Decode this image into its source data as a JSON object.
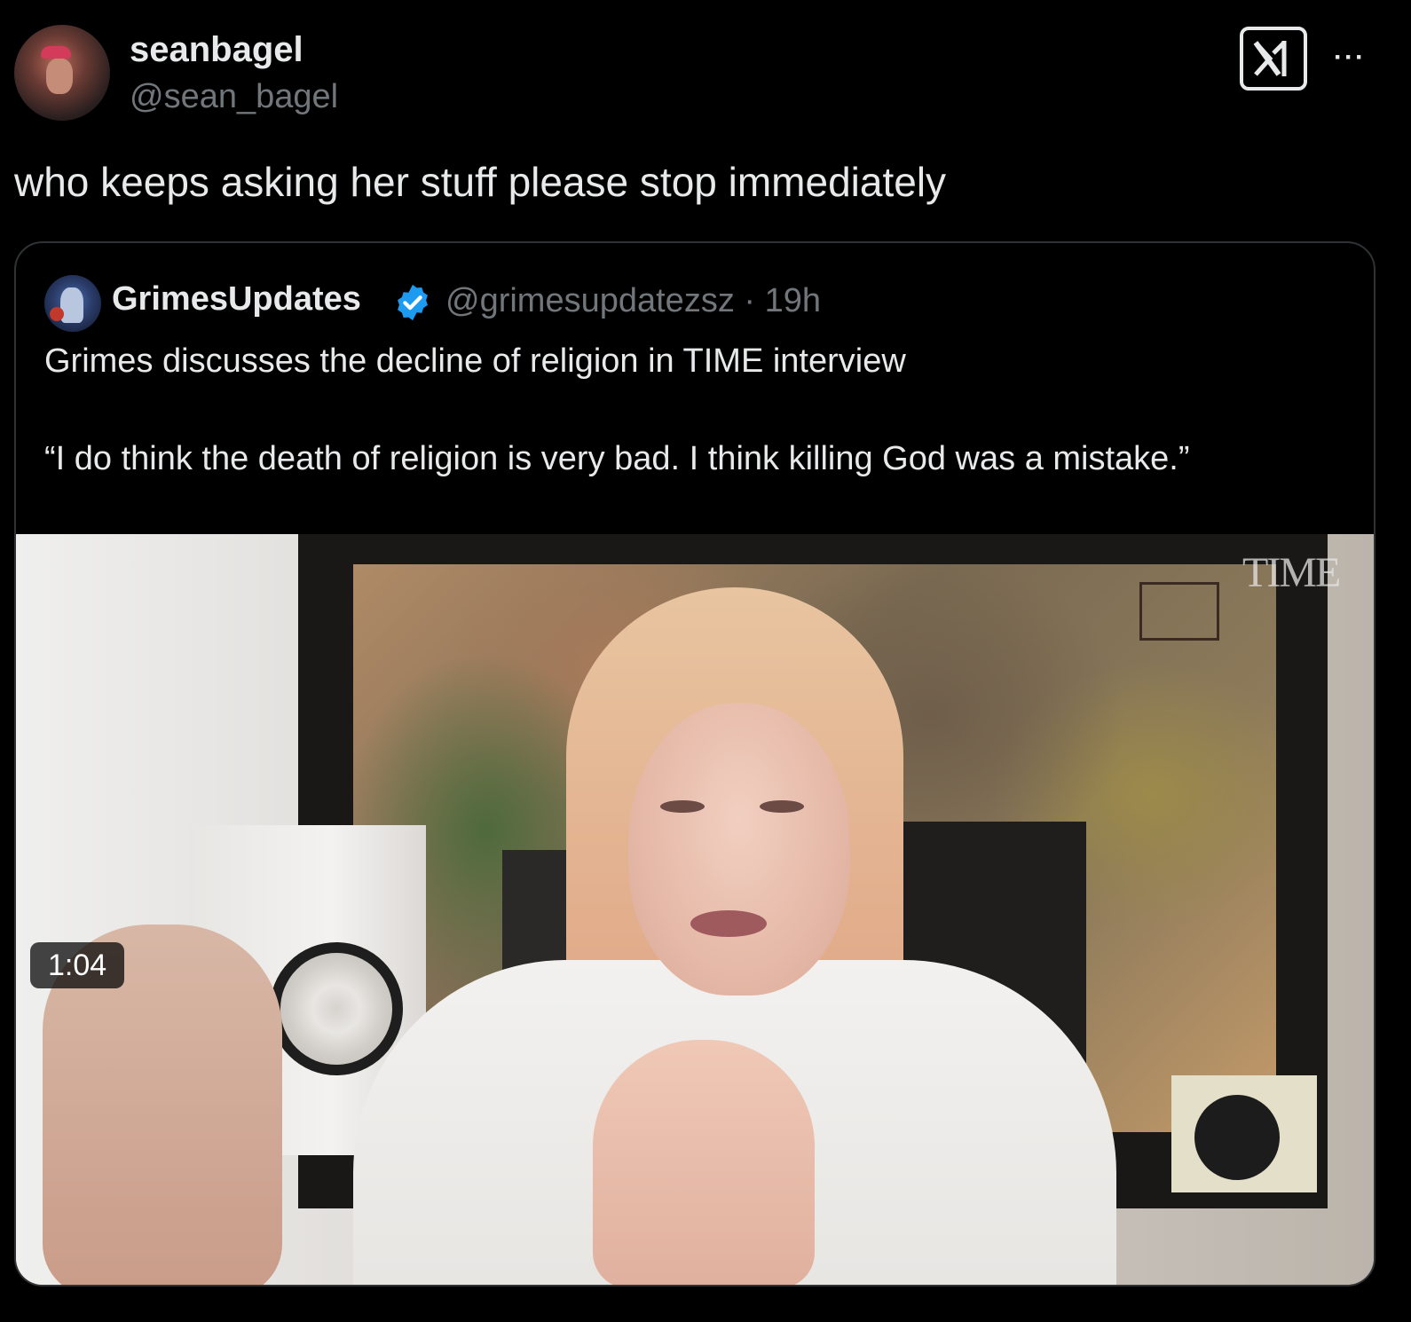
{
  "author": {
    "display_name": "seanbagel",
    "handle": "@sean_bagel"
  },
  "icons": {
    "logo": "x-logo-icon",
    "more": "more-options-icon",
    "verified": "verified-badge-icon"
  },
  "tweet": {
    "text": "who keeps asking her stuff please stop immediately"
  },
  "quoted": {
    "display_name": "GrimesUpdates",
    "handle_time": "@grimesupdatezsz · 19h",
    "line1": "Grimes discusses the decline of religion in TIME interview",
    "line2": "“I do think the death of religion is very bad. I think killing God was a mistake.”",
    "video": {
      "watermark": "TIME",
      "duration": "1:04"
    }
  },
  "colors": {
    "background": "#000000",
    "text_primary": "#e7e9ea",
    "text_secondary": "#71767b",
    "border": "#2f3336",
    "verified_blue": "#1d9bf0"
  },
  "more_label": "···"
}
